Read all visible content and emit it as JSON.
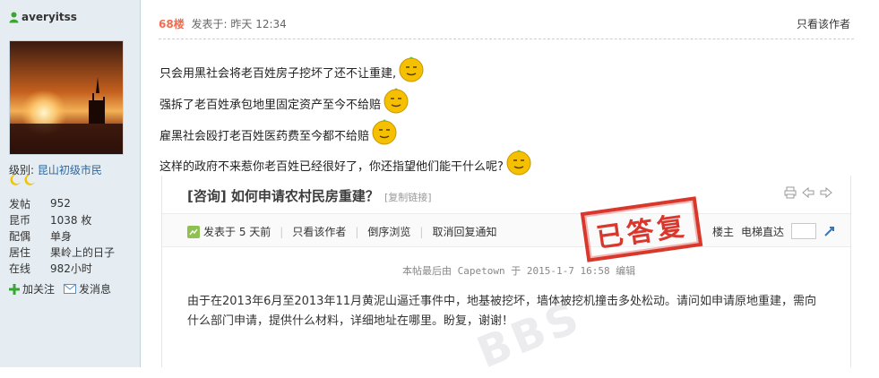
{
  "user": {
    "name": "averyitss",
    "level_label": "级别:",
    "level_value": "昆山初级市民",
    "stats": [
      {
        "key": "发帖",
        "value": "952"
      },
      {
        "key": "昆币",
        "value": "1038 枚"
      },
      {
        "key": "配偶",
        "value": "单身"
      },
      {
        "key": "居住",
        "value": "果岭上的日子"
      },
      {
        "key": "在线",
        "value": "982小时"
      }
    ],
    "follow_label": "加关注",
    "message_label": "发消息"
  },
  "post": {
    "floor": "68楼",
    "posted": "发表于: 昨天 12:34",
    "only_author": "只看该作者",
    "lines": [
      "只会用黑社会将老百姓房子挖坏了还不让重建,",
      "强拆了老百姓承包地里固定资产至今不给赔",
      "雇黑社会殴打老百姓医药费至今都不给赔",
      "这样的政府不来惹你老百姓已经很好了，你还指望他们能干什么呢?"
    ]
  },
  "quote": {
    "title": "[咨询] 如何申请农村民房重建？",
    "copy_link": "[复制链接]",
    "posted": "发表于 5 天前",
    "only_author": "只看该作者",
    "reverse": "倒序浏览",
    "cancel_notify": "取消回复通知",
    "stamp": "已答复",
    "owner": "楼主",
    "elevator": "电梯直达",
    "edit_note": "本帖最后由 Capetown 于 2015-1-7 16:58 编辑",
    "body": "由于在2013年6月至2013年11月黄泥山逼迁事件中，地基被挖坏，墙体被挖机撞击多处松动。请问如申请原地重建，需向什么部门申请，提供什么材料，详细地址在哪里。盼复，谢谢！"
  },
  "colors": {
    "sidebar_bg": "#e5edf2",
    "floor": "#f26c4f",
    "stamp": "#d9372c",
    "link": "#336699"
  }
}
